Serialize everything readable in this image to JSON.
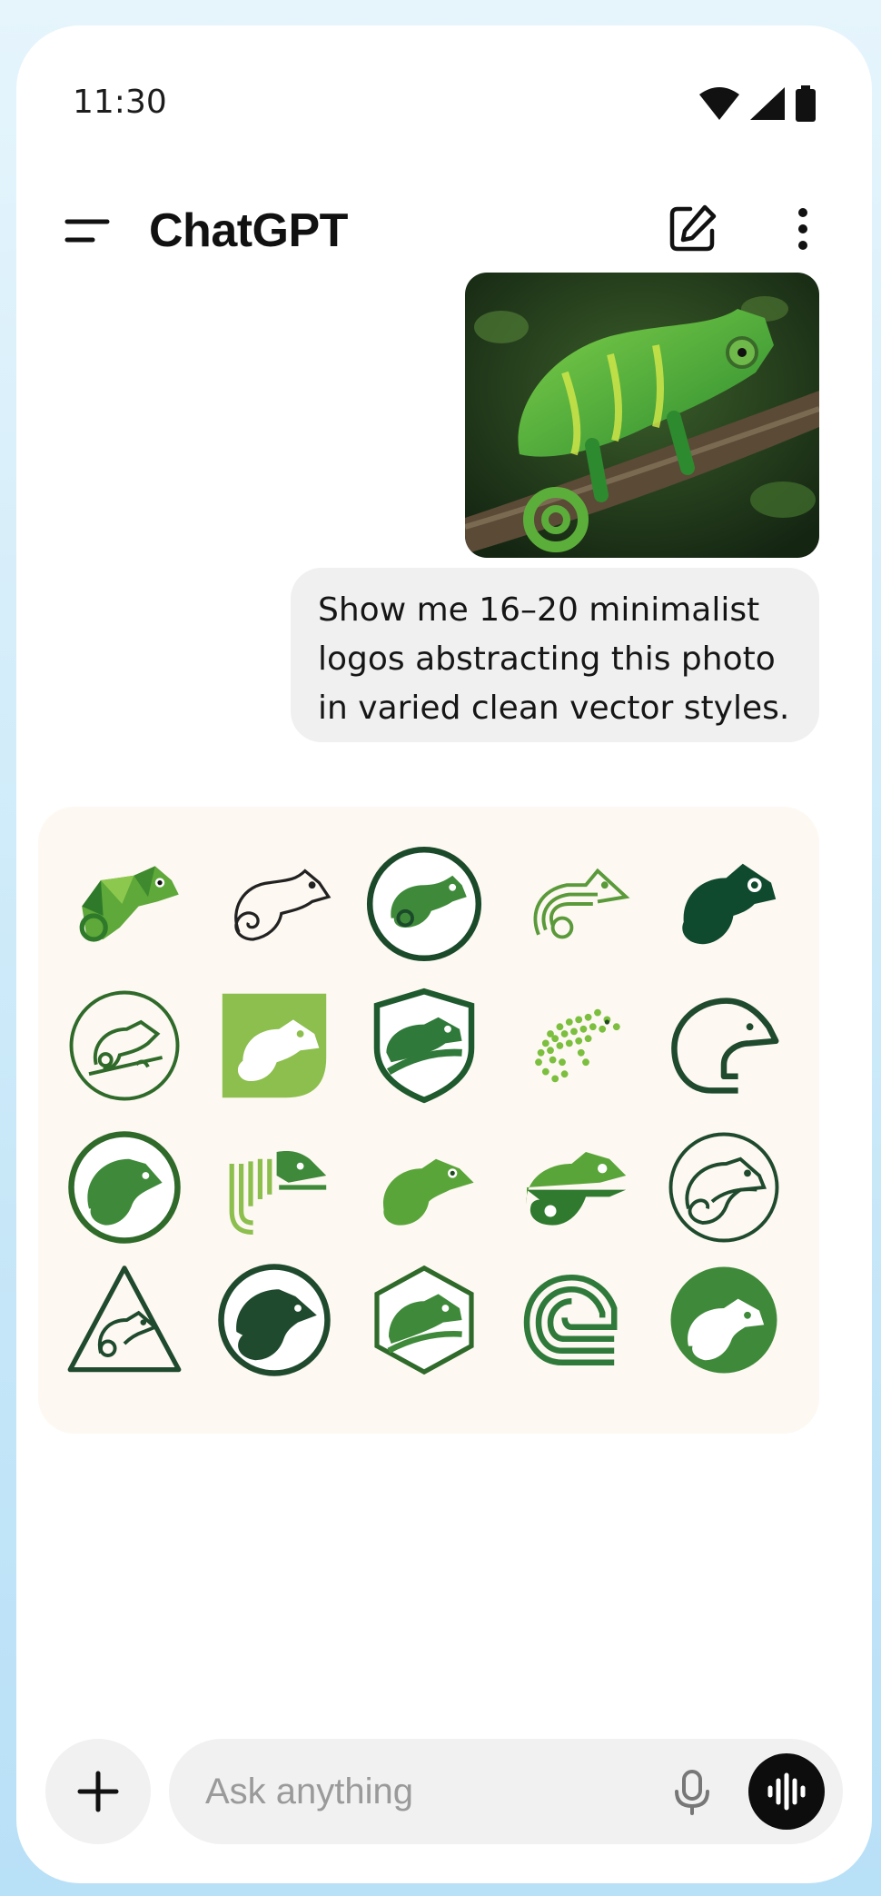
{
  "status_bar": {
    "time": "11:30",
    "icons": [
      "wifi-icon",
      "signal-icon",
      "battery-icon"
    ]
  },
  "app_bar": {
    "title": "ChatGPT",
    "icons": [
      "menu-icon",
      "compose-icon",
      "more-vertical-icon"
    ]
  },
  "conversation": {
    "user_image": {
      "subject": "green chameleon on a branch"
    },
    "user_message": "Show me 16–20 minimalist\nlogos abstracting this photo\nin varied clean vector styles.",
    "assistant_image": {
      "rows": 4,
      "columns": 5,
      "logo_count": 20
    }
  },
  "composer": {
    "placeholder": "Ask anything",
    "icons": [
      "plus-icon",
      "microphone-icon",
      "voice-mode-icon"
    ]
  },
  "colors": {
    "dark_green": "#0f4a2e",
    "mid_green": "#3f8a3a",
    "light_green": "#8cbf4d",
    "panel_bg": "#fdf8f1",
    "bubble_bg": "#f0f0f0"
  }
}
